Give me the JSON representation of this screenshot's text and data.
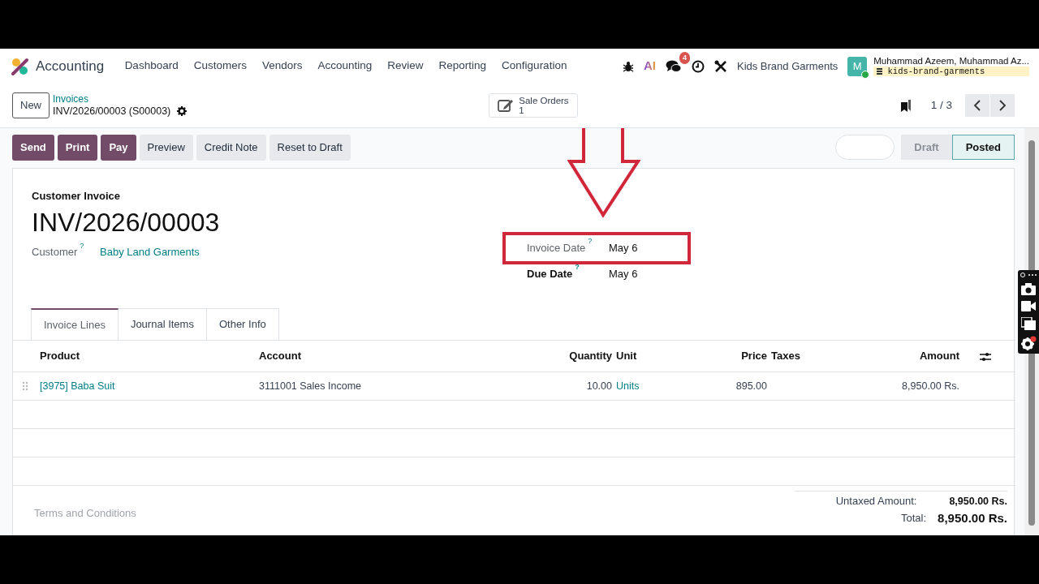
{
  "app": {
    "name": "Accounting"
  },
  "menu": [
    {
      "label": "Dashboard"
    },
    {
      "label": "Customers"
    },
    {
      "label": "Vendors"
    },
    {
      "label": "Accounting"
    },
    {
      "label": "Review"
    },
    {
      "label": "Reporting"
    },
    {
      "label": "Configuration"
    }
  ],
  "systray": {
    "ai_label": "AI",
    "chat_count": "4",
    "company": "Kids Brand Garments",
    "avatar_letter": "M",
    "user": "Muhammad Azeem, Muhammad Az...",
    "database": "kids-brand-garments"
  },
  "control_panel": {
    "new_button": "New",
    "breadcrumb": "Invoices",
    "record": "INV/2026/00003 (S00003)",
    "smart_button": {
      "label": "Sale Orders",
      "count": "1"
    },
    "pager": "1 / 3"
  },
  "actions": [
    {
      "label": "Send",
      "kind": "primary"
    },
    {
      "label": "Print",
      "kind": "primary"
    },
    {
      "label": "Pay",
      "kind": "primary"
    },
    {
      "label": "Preview",
      "kind": "secondary"
    },
    {
      "label": "Credit Note",
      "kind": "secondary"
    },
    {
      "label": "Reset to Draft",
      "kind": "secondary"
    }
  ],
  "statusbar": [
    {
      "label": "Draft",
      "selected": false
    },
    {
      "label": "Posted",
      "selected": true
    }
  ],
  "form": {
    "type_label": "Customer Invoice",
    "number": "INV/2026/00003",
    "customer_label": "Customer",
    "customer_help": "?",
    "customer": "Baby Land Garments",
    "fields": [
      {
        "label": "Invoice Date",
        "help": "?",
        "value": "May 6",
        "bold": false,
        "highlighted": true
      },
      {
        "label": "Due Date",
        "help": "?",
        "value": "May 6",
        "bold": true,
        "highlighted": false
      }
    ]
  },
  "tabs": [
    {
      "label": "Invoice Lines",
      "selected": true
    },
    {
      "label": "Journal Items",
      "selected": false
    },
    {
      "label": "Other Info",
      "selected": false
    }
  ],
  "table": {
    "columns": [
      {
        "label": "Product"
      },
      {
        "label": "Account"
      },
      {
        "label": "Quantity"
      },
      {
        "label": "Unit"
      },
      {
        "label": "Price"
      },
      {
        "label": "Taxes"
      },
      {
        "label": "Amount"
      }
    ],
    "rows": [
      {
        "product": "[3975] Baba Suit",
        "account": "3111001 Sales Income",
        "quantity": "10.00",
        "unit": "Units",
        "price": "895.00",
        "amount": "8,950.00 Rs."
      }
    ]
  },
  "terms_placeholder": "Terms and Conditions",
  "totals": [
    {
      "label": "Untaxed Amount:",
      "value": "8,950.00 Rs.",
      "kind": "subtotal"
    },
    {
      "label": "Total:",
      "value": "8,950.00 Rs.",
      "kind": "total"
    }
  ]
}
